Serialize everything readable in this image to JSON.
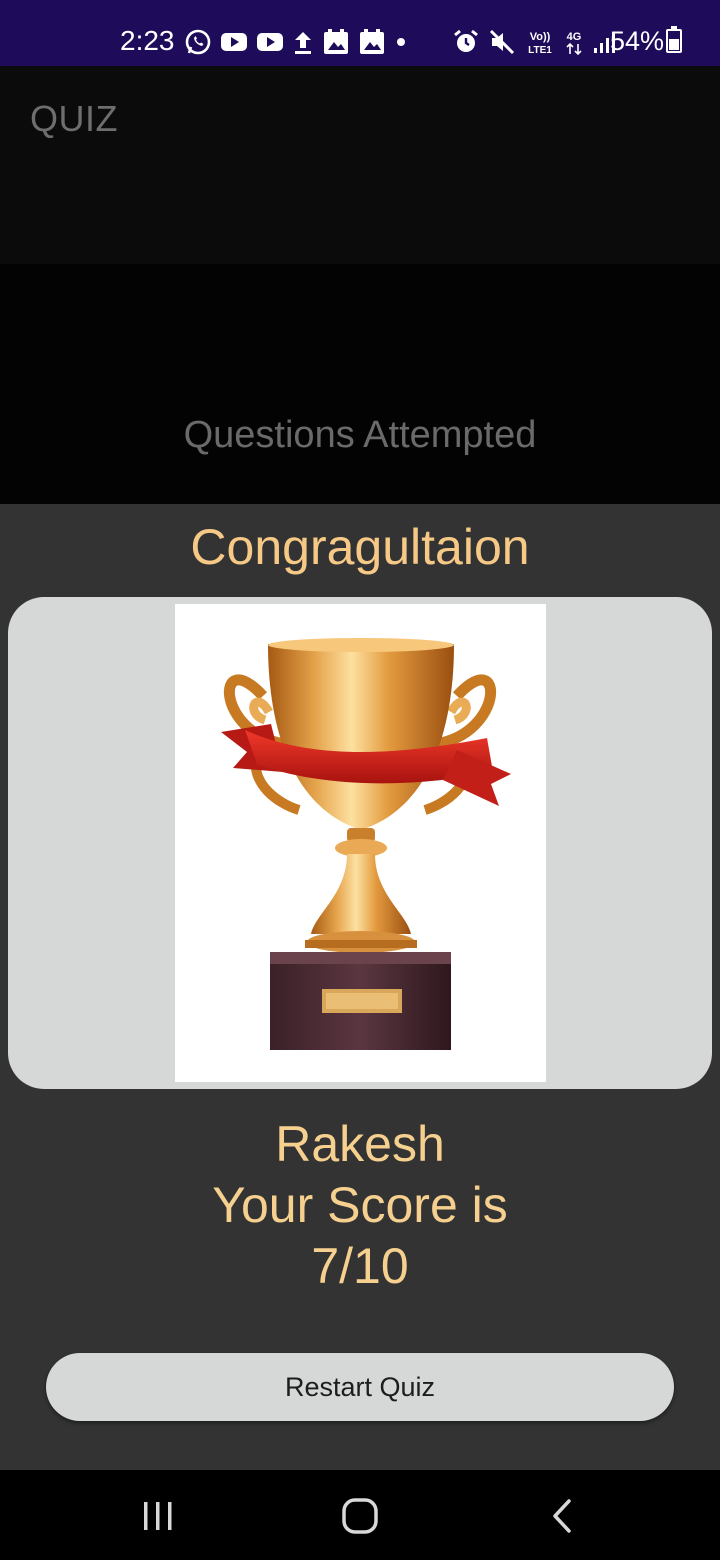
{
  "status_bar": {
    "time": "2:23",
    "battery": "54%",
    "left_icons": [
      "whatsapp-icon",
      "youtube-icon",
      "youtube-icon",
      "upload-icon",
      "gallery-icon",
      "gallery-icon",
      "dot-icon"
    ],
    "right_icons": [
      "alarm-icon",
      "mute-icon",
      "volte-icon",
      "4g-icon",
      "signal-icon"
    ],
    "colors": {
      "background": "#1e0b5a",
      "foreground": "#ffffff"
    }
  },
  "app_bar": {
    "title": "QUIZ"
  },
  "progress": {
    "label": "Questions Attempted"
  },
  "result": {
    "heading": "Congragultaion",
    "image": "trophy-image",
    "player_name": "Rakesh",
    "score_label": "Your Score is",
    "score_value": "7/10"
  },
  "actions": {
    "restart_label": "Restart Quiz"
  },
  "nav_bar": {
    "buttons": [
      "recent-apps-icon",
      "home-icon",
      "back-icon"
    ]
  },
  "colors": {
    "accent_text": "#f6c986",
    "page_background": "#333333",
    "card_background": "#d6d8d8",
    "app_bar_background": "#0b0b0b"
  }
}
